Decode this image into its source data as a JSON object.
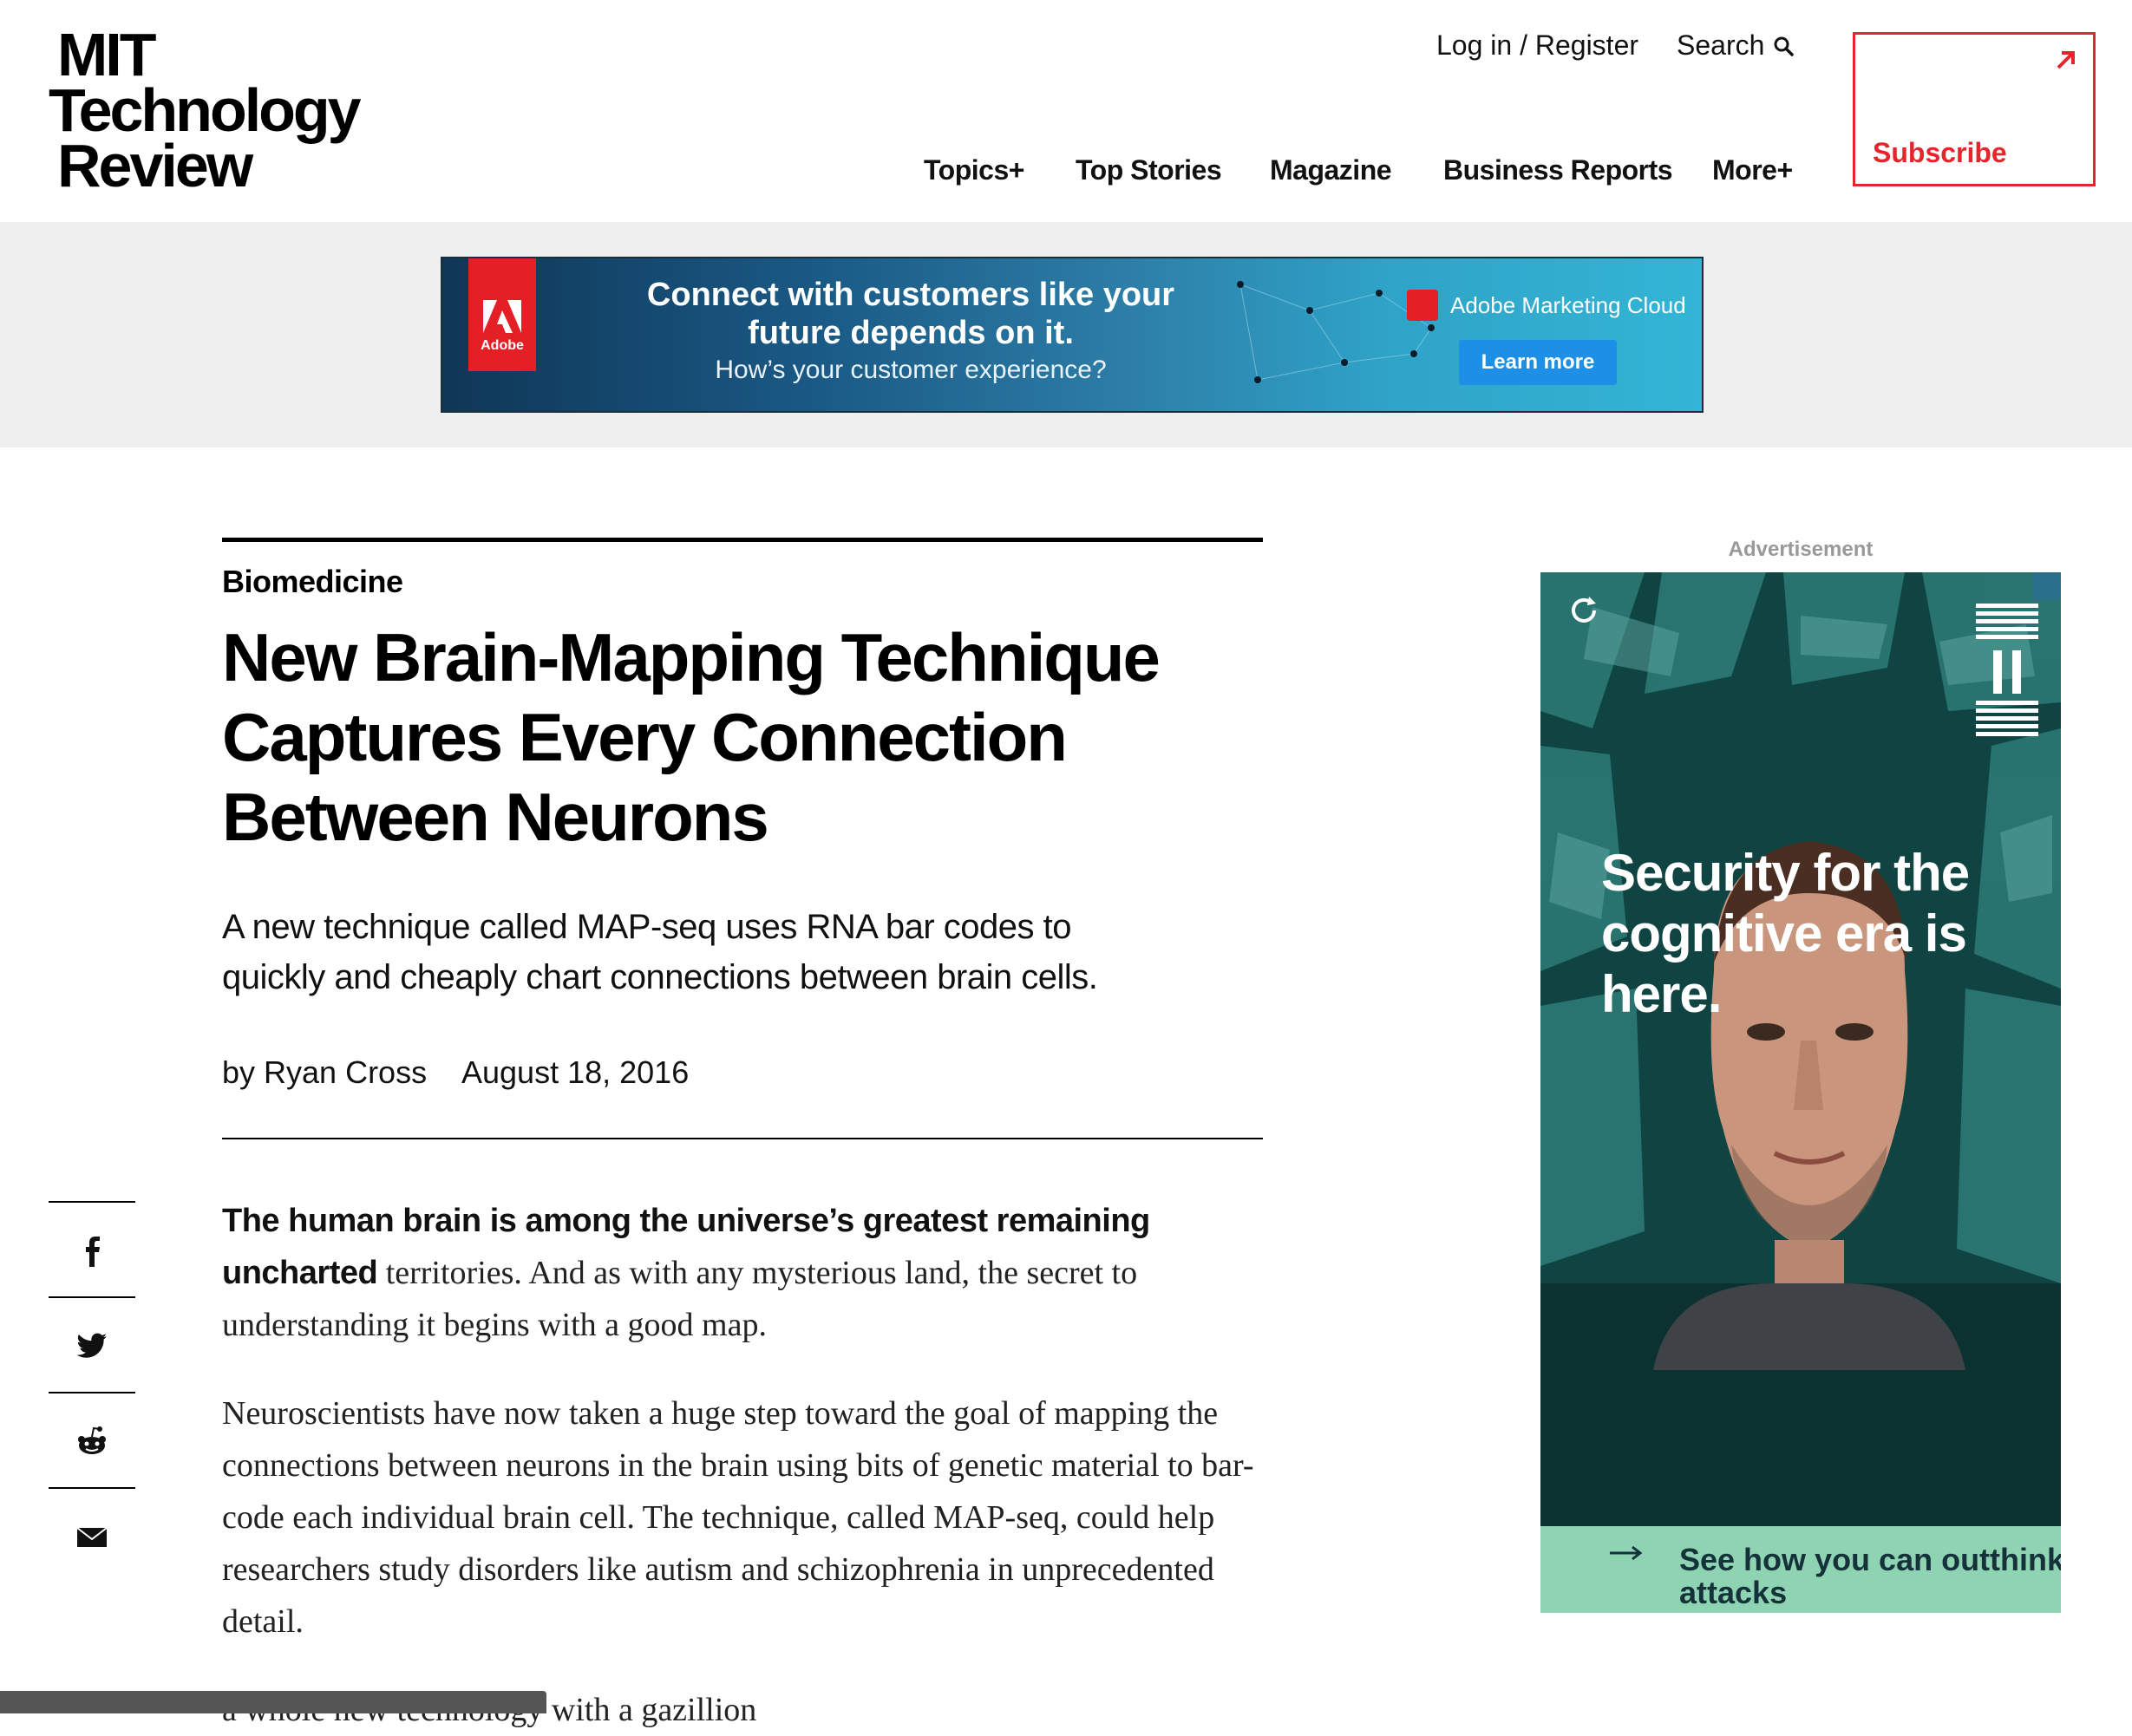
{
  "header": {
    "logo": {
      "line1": "MIT",
      "line2": "Technology",
      "line3": "Review"
    },
    "login_label": "Log in / Register",
    "search_label": "Search",
    "nav": [
      "Topics+",
      "Top Stories",
      "Magazine",
      "Business Reports",
      "More+"
    ],
    "subscribe_label": "Subscribe",
    "accent_color": "#e5252b"
  },
  "banner_ad": {
    "brand": "Adobe",
    "headline": "Connect with customers like your future depends on it.",
    "subline": "How’s your customer experience?",
    "product": "Adobe Marketing Cloud",
    "cta": "Learn more"
  },
  "article": {
    "section": "Biomedicine",
    "title": "New Brain-Mapping Technique Captures Every Connection Between Neurons",
    "dek": "A new technique called MAP-seq uses RNA bar codes to quickly and cheaply chart connections between brain cells.",
    "byline": "by Ryan Cross",
    "date": "August 18, 2016",
    "p1_lead": "The human brain is among the universe’s greatest remaining uncharted",
    "p1_rest": " territories. And as with any mysterious land, the secret to understanding it begins with a good map.",
    "p2": "Neuroscientists have now taken a huge step toward the goal of mapping the connections between neurons in the brain using bits of genetic material to bar-code each individual brain cell. The technique, called MAP-seq, could help researchers study disorders like autism and schizophrenia in unprecedented detail.",
    "p3_partial": "a whole new technology with a gazillion"
  },
  "share": [
    "facebook-icon",
    "twitter-icon",
    "reddit-icon",
    "email-icon"
  ],
  "side_ad": {
    "label": "Advertisement",
    "headline": "Security for the cognitive era is here.",
    "cta": "See how you can outthink attacks"
  }
}
